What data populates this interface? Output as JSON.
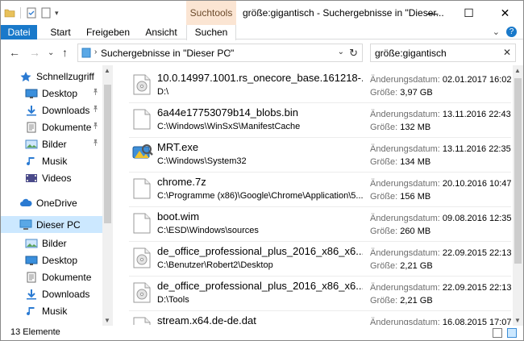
{
  "window": {
    "context_tab": "Suchtools",
    "title": "größe:gigantisch - Suchergebnisse in \"Dieser...",
    "minimize_glyph": "—",
    "maximize_glyph": "☐",
    "close_glyph": "✕"
  },
  "ribbon": {
    "tabs": [
      "Datei",
      "Start",
      "Freigeben",
      "Ansicht",
      "Suchen"
    ],
    "collapse_glyph": "⌄",
    "help_glyph": "?"
  },
  "nav": {
    "back_glyph": "←",
    "forward_glyph": "→",
    "recent_glyph": "⌄",
    "up_glyph": "↑",
    "breadcrumb": "Suchergebnisse in \"Dieser PC\"",
    "chevron": "›",
    "dropdown_glyph": "⌄",
    "refresh_glyph": "↻"
  },
  "search": {
    "value": "größe:gigantisch",
    "clear_glyph": "✕"
  },
  "sidebar": {
    "items": [
      {
        "label": "Schnellzugriff",
        "icon": "star-icon",
        "pinned": false
      },
      {
        "label": "Desktop",
        "icon": "desktop-icon",
        "pinned": true
      },
      {
        "label": "Downloads",
        "icon": "download-icon",
        "pinned": true
      },
      {
        "label": "Dokumente",
        "icon": "documents-icon",
        "pinned": true
      },
      {
        "label": "Bilder",
        "icon": "pictures-icon",
        "pinned": true
      },
      {
        "label": "Musik",
        "icon": "music-icon",
        "pinned": false
      },
      {
        "label": "Videos",
        "icon": "video-icon",
        "pinned": false
      },
      {
        "label": "OneDrive",
        "icon": "cloud-icon",
        "pinned": false
      },
      {
        "label": "Dieser PC",
        "icon": "computer-icon",
        "pinned": false
      },
      {
        "label": "Bilder",
        "icon": "pictures-icon",
        "pinned": false
      },
      {
        "label": "Desktop",
        "icon": "desktop-icon",
        "pinned": false
      },
      {
        "label": "Dokumente",
        "icon": "documents-icon",
        "pinned": false
      },
      {
        "label": "Downloads",
        "icon": "download-icon",
        "pinned": false
      },
      {
        "label": "Musik",
        "icon": "music-icon",
        "pinned": false
      }
    ],
    "pin_glyph": "📌"
  },
  "labels": {
    "date": "Änderungsdatum:",
    "size": "Größe:"
  },
  "files": [
    {
      "name": "10.0.14997.1001.rs_onecore_base.161218-...",
      "path": "D:\\",
      "date": "02.01.2017 16:02",
      "size": "3,97 GB",
      "icon": "disc-image-icon"
    },
    {
      "name": "6a44e17753079b14_blobs.bin",
      "path": "C:\\Windows\\WinSxS\\ManifestCache",
      "date": "13.11.2016 22:43",
      "size": "132 MB",
      "icon": "file-icon"
    },
    {
      "name": "MRT.exe",
      "path": "C:\\Windows\\System32",
      "date": "13.11.2016 22:35",
      "size": "134 MB",
      "icon": "mrt-app-icon"
    },
    {
      "name": "chrome.7z",
      "path": "C:\\Programme (x86)\\Google\\Chrome\\Application\\5...",
      "date": "20.10.2016 10:47",
      "size": "156 MB",
      "icon": "file-icon"
    },
    {
      "name": "boot.wim",
      "path": "C:\\ESD\\Windows\\sources",
      "date": "09.08.2016 12:35",
      "size": "260 MB",
      "icon": "file-icon"
    },
    {
      "name": "de_office_professional_plus_2016_x86_x6...",
      "path": "C:\\Benutzer\\Robert2\\Desktop",
      "date": "22.09.2015 22:13",
      "size": "2,21 GB",
      "icon": "disc-image-icon"
    },
    {
      "name": "de_office_professional_plus_2016_x86_x6...",
      "path": "D:\\Tools",
      "date": "22.09.2015 22:13",
      "size": "2,21 GB",
      "icon": "disc-image-icon"
    },
    {
      "name": "stream.x64.de-de.dat",
      "path": "",
      "date": "16.08.2015 17:07",
      "size": "",
      "icon": "file-icon"
    }
  ],
  "status": {
    "count": "13 Elemente"
  },
  "colors": {
    "file_tab": "#1979ca",
    "context_tab": "#fbe5d3",
    "selection": "#cce8ff"
  }
}
